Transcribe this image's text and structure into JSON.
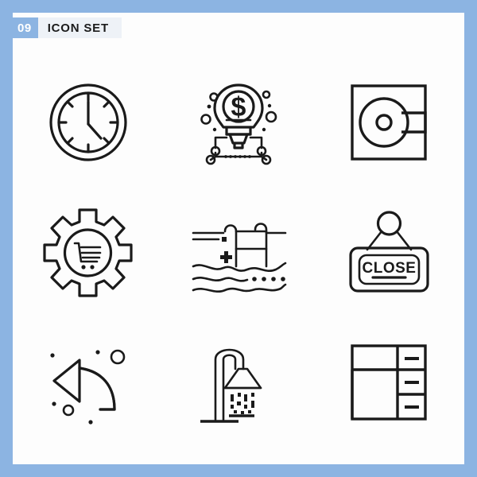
{
  "page": {
    "frame_color": "#8cb4e2",
    "canvas_color": "#fdfdfd",
    "stroke_color": "#1a1a1a"
  },
  "header": {
    "number": "09",
    "title": "ICON SET",
    "number_bg": "#8cb4e2",
    "number_fg": "#ffffff",
    "title_bg": "#eef2f7",
    "title_fg": "#1b1b1b"
  },
  "grid": {
    "rows": 3,
    "columns": 3,
    "icons": [
      {
        "name": "wall-clock-icon",
        "label": "Wall Clock"
      },
      {
        "name": "idea-money-bulb-icon",
        "label": "Money Idea Lightbulb",
        "glyph": "$"
      },
      {
        "name": "compact-disc-case-icon",
        "label": "Compact Disc Case"
      },
      {
        "name": "ecommerce-gear-icon",
        "label": "Shopping Cart Gear"
      },
      {
        "name": "swimming-pool-icon",
        "label": "Swimming Pool"
      },
      {
        "name": "close-sign-icon",
        "label": "Close Sign",
        "glyph": "CLOSE"
      },
      {
        "name": "undo-arrow-icon",
        "label": "Undo Curved Arrow"
      },
      {
        "name": "shower-icon",
        "label": "Shower"
      },
      {
        "name": "office-desk-icon",
        "label": "Office Desk"
      }
    ]
  }
}
